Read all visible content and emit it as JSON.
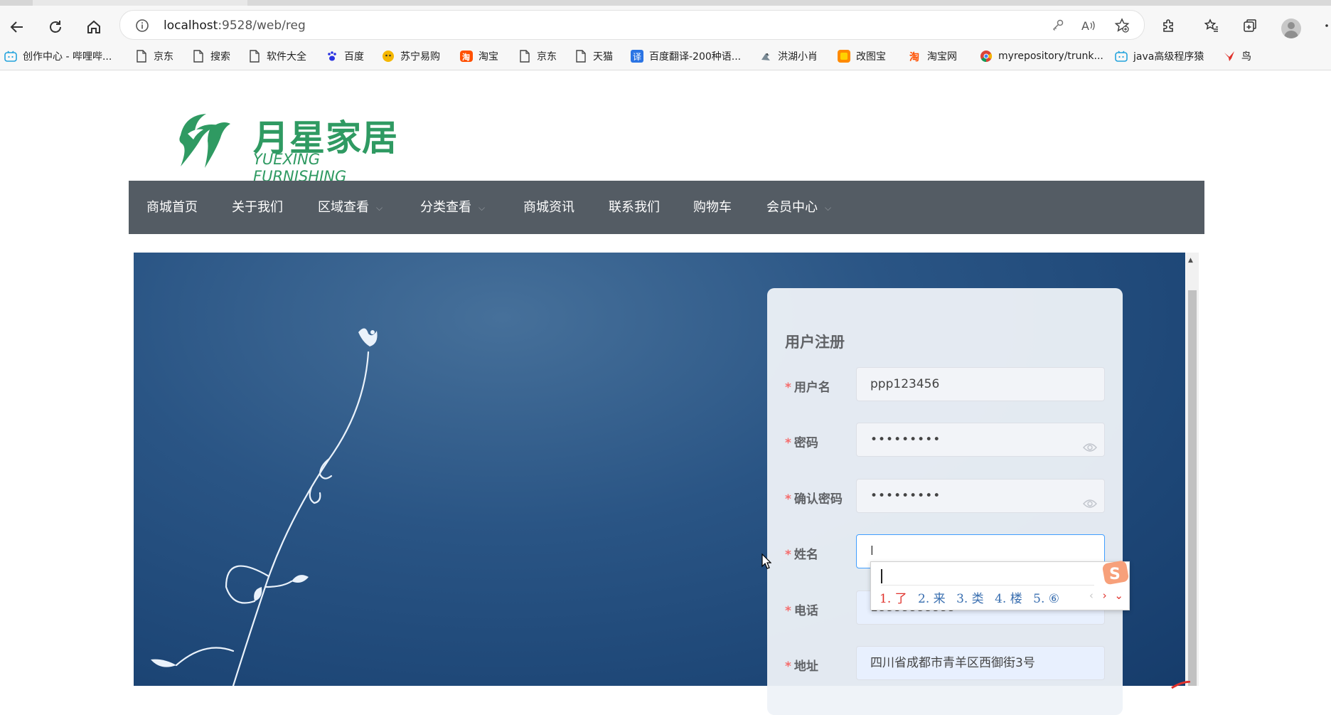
{
  "browser": {
    "url_host": "localhost",
    "url_rest": ":9528/web/reg",
    "bookmarks": [
      {
        "label": "创作中心 - 哔哩哔...",
        "icon": "bilibili-icon"
      },
      {
        "label": "京东",
        "icon": "page-icon"
      },
      {
        "label": "搜索",
        "icon": "page-icon"
      },
      {
        "label": "软件大全",
        "icon": "page-icon"
      },
      {
        "label": "百度",
        "icon": "baidu-paw-icon"
      },
      {
        "label": "苏宁易购",
        "icon": "suning-icon"
      },
      {
        "label": "淘宝",
        "icon": "taobao-icon"
      },
      {
        "label": "京东",
        "icon": "page-icon"
      },
      {
        "label": "天猫",
        "icon": "page-icon"
      },
      {
        "label": "百度翻译-200种语...",
        "icon": "baidu-translate-icon"
      },
      {
        "label": "洪湖小肖",
        "icon": "bird-icon"
      },
      {
        "label": "改图宝",
        "icon": "gaitubao-icon"
      },
      {
        "label": "淘宝网",
        "icon": "taobao-icon"
      },
      {
        "label": "myrepository/trunk...",
        "icon": "chrome-icon"
      },
      {
        "label": "java高级程序猿",
        "icon": "bilibili-icon"
      },
      {
        "label": "鸟",
        "icon": "bird-red-icon"
      }
    ]
  },
  "site": {
    "brand_cn": "月星家居",
    "brand_en": "YUEXING FURNISHING",
    "nav": [
      {
        "label": "商城首页",
        "dropdown": false
      },
      {
        "label": "关于我们",
        "dropdown": false
      },
      {
        "label": "区域查看",
        "dropdown": true
      },
      {
        "label": "分类查看",
        "dropdown": true
      },
      {
        "label": "商城资讯",
        "dropdown": false
      },
      {
        "label": "联系我们",
        "dropdown": false
      },
      {
        "label": "购物车",
        "dropdown": false
      },
      {
        "label": "会员中心",
        "dropdown": true
      }
    ]
  },
  "form": {
    "title": "用户注册",
    "required_mark": "*",
    "fields": [
      {
        "label": "用户名",
        "value": "ppp123456",
        "type": "text"
      },
      {
        "label": "密码",
        "value": "•••••••••",
        "type": "password"
      },
      {
        "label": "确认密码",
        "value": "•••••••••",
        "type": "password"
      },
      {
        "label": "姓名",
        "value": "l",
        "type": "text"
      },
      {
        "label": "电话",
        "value": "18888888888",
        "type": "text"
      },
      {
        "label": "地址",
        "value": "四川省成都市青羊区西御街3号",
        "type": "text"
      }
    ]
  },
  "ime": {
    "composition": "l",
    "candidates": [
      "1. 了",
      "2. 来",
      "3. 类",
      "4. 楼",
      "5. ⑥"
    ],
    "brand_letter": "S"
  },
  "colors": {
    "nav_bg": "#545c64",
    "brand_green": "#2f9a62",
    "required_red": "#f56c6c",
    "focus_blue": "#409eff"
  }
}
